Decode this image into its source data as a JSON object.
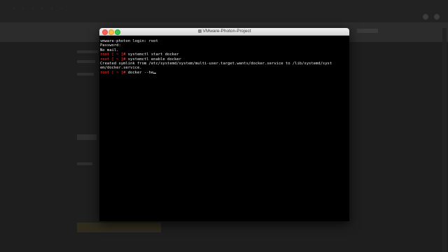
{
  "window": {
    "title": "VMware-Photon-Project"
  },
  "terminal": {
    "lines": [
      {
        "text": "vmware-photon login: root"
      },
      {
        "text": "Password:"
      },
      {
        "text": "No mail."
      },
      {
        "prompt": "root [ ~ ]#",
        "command": " systemctl start docker"
      },
      {
        "prompt": "root [ ~ ]#",
        "command": " systemctl enable docker"
      },
      {
        "text": "Created symlink from /etc/systemd/system/multi-user.target.wants/docker.service to /lib/systemd/syst"
      },
      {
        "text": "em/docker.service."
      },
      {
        "prompt": "root [ ~ ]#",
        "command": " docker --he"
      }
    ]
  },
  "colors": {
    "prompt": "#ff3d3d",
    "terminal_text": "#ececec",
    "terminal_bg": "#000000"
  }
}
